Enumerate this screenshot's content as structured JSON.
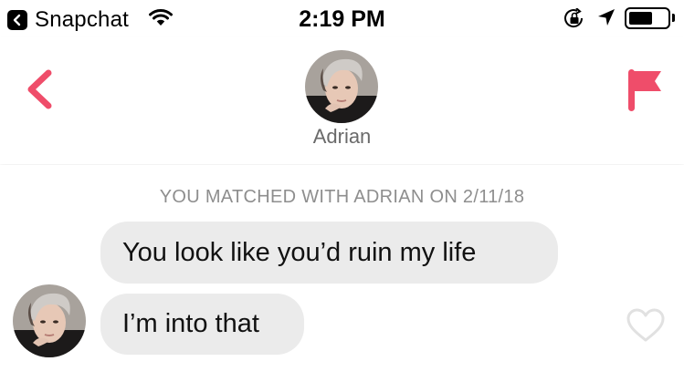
{
  "status_bar": {
    "back_app_label": "Snapchat",
    "time": "2:19 PM",
    "battery_level": 0.62,
    "icons": [
      "chevron-left-icon",
      "wifi-icon",
      "rotation-lock-icon",
      "location-arrow-icon",
      "battery-icon"
    ]
  },
  "header": {
    "contact_name": "Adrian",
    "icons": [
      "back-chevron-icon",
      "flag-icon"
    ],
    "accent_color": "#ef4d6a"
  },
  "conversation": {
    "match_notice": "YOU MATCHED WITH ADRIAN ON 2/11/18",
    "messages": [
      {
        "text": "You look like you’d ruin my life"
      },
      {
        "text": "I’m into that"
      }
    ],
    "bubble_color": "#ebebeb",
    "like_icon": "heart-icon"
  }
}
